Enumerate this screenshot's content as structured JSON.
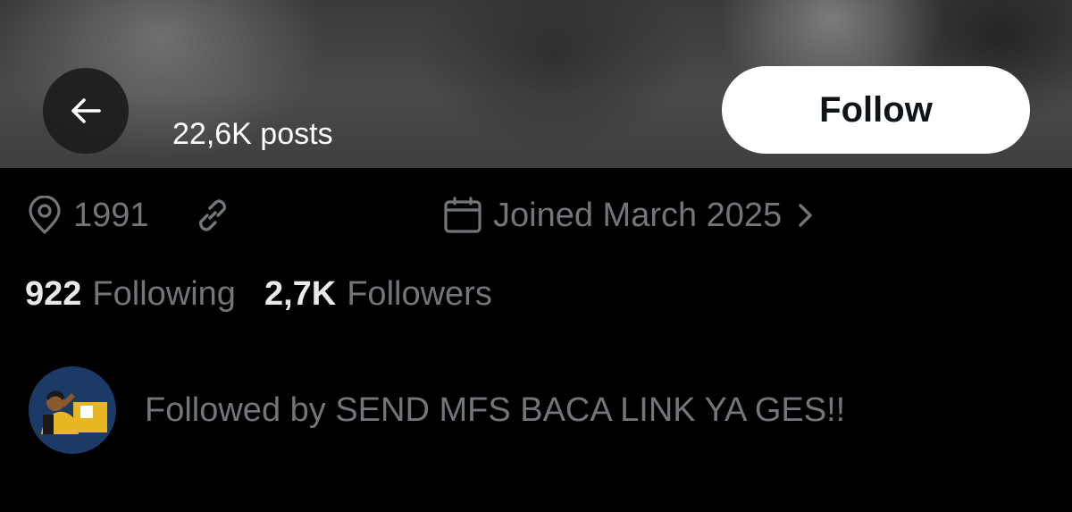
{
  "header": {
    "posts_count": "22,6K posts",
    "back_icon": "arrow-left-icon",
    "follow_label": "Follow"
  },
  "meta": {
    "location_icon": "location-pin-icon",
    "location": "1991",
    "link_icon": "link-icon",
    "calendar_icon": "calendar-icon",
    "joined": "Joined March 2025",
    "chevron_icon": "chevron-right-icon"
  },
  "stats": {
    "following_count": "922",
    "following_label": "Following",
    "followers_count": "2,7K",
    "followers_label": "Followers"
  },
  "followed_by": {
    "text": "Followed by SEND MFS BACA LINK YA GES!!"
  },
  "colors": {
    "background": "#000000",
    "muted_text": "#71767b",
    "primary_text": "#e7e9ea",
    "follow_button_bg": "#ffffff",
    "avatar_bg": "#1c3a66"
  }
}
